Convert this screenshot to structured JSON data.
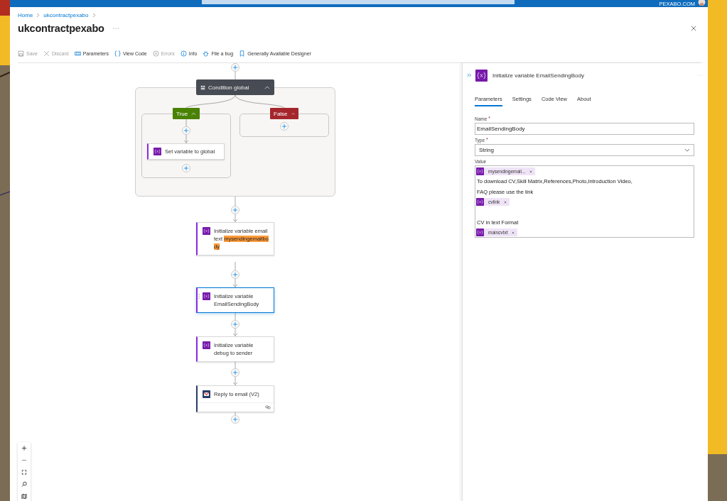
{
  "account": "PEXABO.COM",
  "breadcrumb": [
    {
      "label": "Home"
    },
    {
      "label": "ukcontractpexabo"
    }
  ],
  "title": "ukcontractpexabo",
  "toolbar": [
    {
      "kind": "save",
      "label": "Save",
      "disabled": true
    },
    {
      "kind": "discard",
      "label": "Discard",
      "disabled": true
    },
    {
      "kind": "parameters",
      "label": "Parameters",
      "disabled": false
    },
    {
      "kind": "code",
      "label": "View Code",
      "disabled": false
    },
    {
      "kind": "errors",
      "label": "Errors",
      "disabled": true
    },
    {
      "kind": "info",
      "label": "Info",
      "disabled": false
    },
    {
      "kind": "bug",
      "label": "File a bug",
      "disabled": false
    },
    {
      "kind": "designer",
      "label": "Generally Available Designer",
      "disabled": false
    }
  ],
  "condition": {
    "title": "Condition global",
    "true_label": "True",
    "false_label": "False",
    "true_actions": [
      {
        "title": "Set variable to global",
        "selected": false
      }
    ]
  },
  "actions": [
    {
      "kind": "variable",
      "title": "Initialize variable email text",
      "highlight": "mysendingemailbody",
      "selected": false
    },
    {
      "kind": "variable",
      "title": "Initialize variable EmailSendingBody",
      "selected": true
    },
    {
      "kind": "variable",
      "title": "Initialize variable debug to sender",
      "selected": false
    },
    {
      "kind": "email",
      "title": "Reply to email (V2)",
      "selected": false
    }
  ],
  "panel": {
    "title": "Initialize variable EmailSendingBody",
    "tabs": [
      {
        "label": "Parameters",
        "selected": true
      },
      {
        "label": "Settings",
        "selected": false
      },
      {
        "label": "Code View",
        "selected": false
      },
      {
        "label": "About",
        "selected": false
      }
    ],
    "name": {
      "label": "Name",
      "required_mark": "*",
      "value": "EmailSendingBody"
    },
    "type": {
      "label": "Type",
      "required_mark": "*",
      "value": "String"
    },
    "value": {
      "label": "Value",
      "content": [
        {
          "kind": "token",
          "label": "mysendingemail..."
        },
        {
          "kind": "text",
          "text": "To download CV,Skill Matrix,References,Photo,Introduction Video,"
        },
        {
          "kind": "text",
          "text": "FAQ please use the link"
        },
        {
          "kind": "token",
          "label": "cvlink"
        },
        {
          "kind": "blank"
        },
        {
          "kind": "text",
          "text": "CV in text Format"
        },
        {
          "kind": "token",
          "label": "maincvtxt"
        }
      ]
    }
  }
}
